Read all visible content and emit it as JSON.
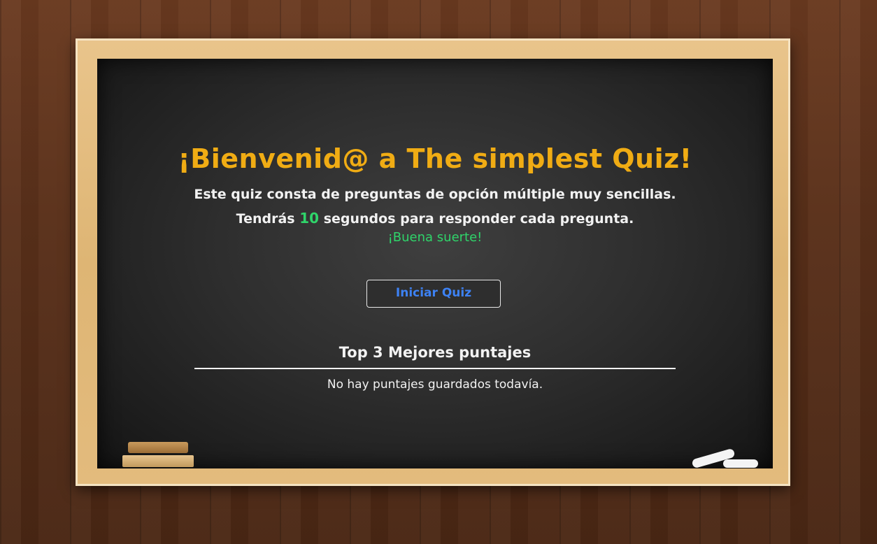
{
  "colors": {
    "title": "#f0ac14",
    "highlight": "#2fd46a",
    "button_text": "#3d82f5",
    "text": "#f2f2f2",
    "board": "#2e2e2e",
    "frame": "#deb574"
  },
  "welcome": {
    "title": "¡Bienvenid@ a The simplest Quiz!",
    "line1": "Este quiz consta de preguntas de opción múltiple muy sencillas.",
    "line2_before": "Tendrás ",
    "seconds": "10",
    "line2_after": " segundos para responder cada pregunta.",
    "good_luck": "¡Buena suerte!"
  },
  "start_button": {
    "label": "Iniciar Quiz"
  },
  "scores": {
    "title": "Top 3 Mejores puntajes",
    "empty_message": "No hay puntajes guardados todavía."
  },
  "decor": {
    "eraser_icon": "eraser-icon",
    "chalk_icon": "chalk-icon"
  }
}
